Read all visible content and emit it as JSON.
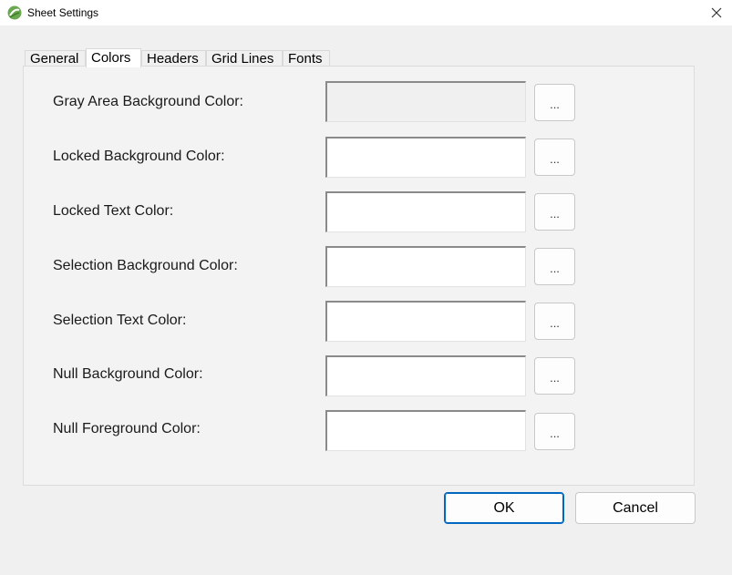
{
  "window": {
    "title": "Sheet Settings",
    "accent_color": "#0067c0"
  },
  "tabs": [
    {
      "label": "General",
      "active": false
    },
    {
      "label": "Colors",
      "active": true
    },
    {
      "label": "Headers",
      "active": false
    },
    {
      "label": "Grid Lines",
      "active": false
    },
    {
      "label": "Fonts",
      "active": false
    }
  ],
  "colors": {
    "rows": [
      {
        "label": "Gray Area Background Color:",
        "color": "#f0f0f0",
        "button": "..."
      },
      {
        "label": "Locked Background Color:",
        "color": "#ffffff",
        "button": "..."
      },
      {
        "label": "Locked Text Color:",
        "color": "#ffffff",
        "button": "..."
      },
      {
        "label": "Selection Background Color:",
        "color": "#ffffff",
        "button": "..."
      },
      {
        "label": "Selection Text Color:",
        "color": "#ffffff",
        "button": "..."
      },
      {
        "label": "Null Background Color:",
        "color": "#ffffff",
        "button": "..."
      },
      {
        "label": "Null Foreground Color:",
        "color": "#ffffff",
        "button": "..."
      }
    ]
  },
  "buttons": {
    "ok": "OK",
    "cancel": "Cancel"
  }
}
